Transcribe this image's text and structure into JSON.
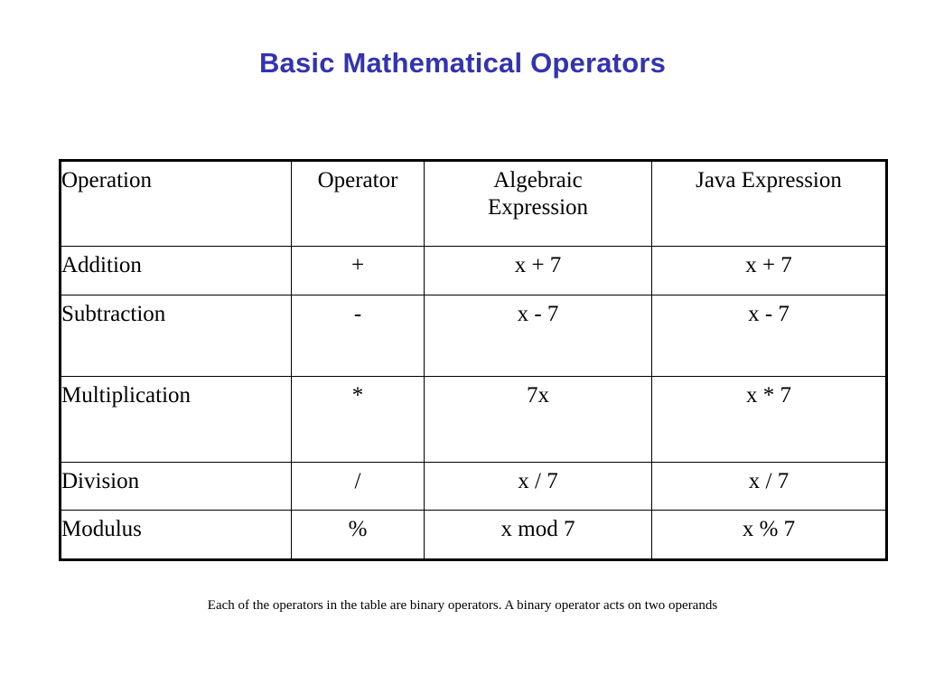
{
  "slide": {
    "title": "Basic Mathematical Operators",
    "title_color": "#3333b2",
    "background_color": "#ffffff",
    "text_color": "#000000"
  },
  "table": {
    "headers": {
      "operation": "Operation",
      "operator": "Operator",
      "algebraic": "Algebraic Expression",
      "algebraic_line1": "Algebraic",
      "algebraic_line2": "Expression",
      "java": "Java Expression"
    },
    "rows": [
      {
        "operation": "Addition",
        "operator": "+",
        "algebraic": "x + 7",
        "java": "x + 7"
      },
      {
        "operation": "Subtraction",
        "operator": "-",
        "algebraic": "x - 7",
        "java": "x - 7"
      },
      {
        "operation": "Multiplication",
        "operator": "*",
        "algebraic": "7x",
        "java": "x * 7"
      },
      {
        "operation": "Division",
        "operator": "/",
        "algebraic": "x / 7",
        "java": "x / 7"
      },
      {
        "operation": "Modulus",
        "operator": "%",
        "algebraic": "x mod 7",
        "java": "x % 7"
      }
    ]
  },
  "caption": "Each of the operators in the table are binary operators.  A binary operator acts on two operands"
}
